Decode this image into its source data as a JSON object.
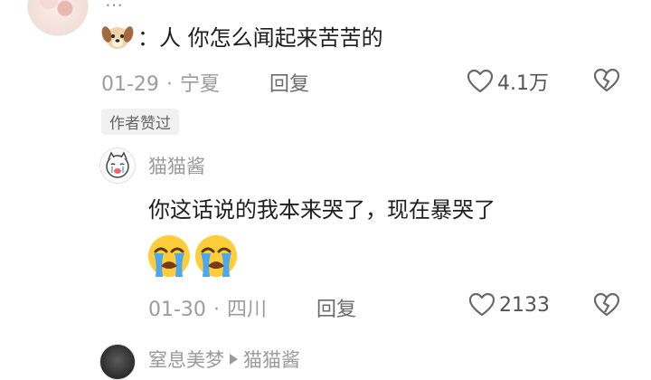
{
  "top_comment": {
    "username_partial": "…",
    "prefix": "：",
    "text": "人 你怎么闻起来苦苦的",
    "date": "01-29",
    "location": "宁夏",
    "reply_label": "回复",
    "like_count": "4.1万",
    "author_badge": "作者赞过"
  },
  "reply_comment": {
    "username": "猫猫酱",
    "text": "你这话说的我本来哭了，现在暴哭了",
    "date": "01-30",
    "location": "四川",
    "reply_label": "回复",
    "like_count": "2133"
  },
  "bottom_comment": {
    "username": "窒息美梦",
    "reply_to": "猫猫酱"
  },
  "separator": "·",
  "icons": {
    "like": "heart-outline-icon",
    "dislike": "broken-heart-icon",
    "dog": "dog-face-emoji",
    "crying": "loudly-crying-face-emoji"
  },
  "colors": {
    "text": "#1e1e1e",
    "meta": "#9c9c9c",
    "badge_bg": "#f1f1f1"
  }
}
